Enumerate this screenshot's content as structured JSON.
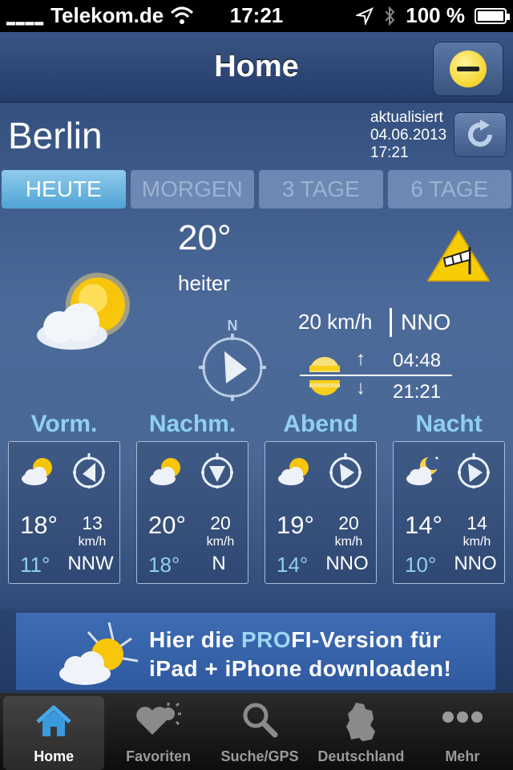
{
  "statusbar": {
    "carrier": "Telekom.de",
    "time": "17:21",
    "battery": "100 %"
  },
  "navbar": {
    "title": "Home"
  },
  "location": {
    "city": "Berlin",
    "updated_label": "aktualisiert",
    "updated_date": "04.06.2013",
    "updated_time": "17:21"
  },
  "tabs": [
    {
      "label": "HEUTE",
      "active": true
    },
    {
      "label": "MORGEN",
      "active": false
    },
    {
      "label": "3 TAGE",
      "active": false
    },
    {
      "label": "6 TAGE",
      "active": false
    }
  ],
  "current": {
    "temperature": "20°",
    "condition": "heiter",
    "wind_speed": "20 km/h",
    "wind_direction": "NNO",
    "compass_label": "N",
    "sunrise": "04:48",
    "sunset": "21:21"
  },
  "periods": [
    {
      "name": "Vorm.",
      "tmax": "18°",
      "tmin": "11°",
      "wind_speed": "13",
      "wind_unit": "km/h",
      "wind_dir": "NNW",
      "icon": "sun-cloud-icon"
    },
    {
      "name": "Nachm.",
      "tmax": "20°",
      "tmin": "18°",
      "wind_speed": "20",
      "wind_unit": "km/h",
      "wind_dir": "N",
      "icon": "sun-cloud-icon"
    },
    {
      "name": "Abend",
      "tmax": "19°",
      "tmin": "14°",
      "wind_speed": "20",
      "wind_unit": "km/h",
      "wind_dir": "NNO",
      "icon": "sun-cloud-icon"
    },
    {
      "name": "Nacht",
      "tmax": "14°",
      "tmin": "10°",
      "wind_speed": "14",
      "wind_unit": "km/h",
      "wind_dir": "NNO",
      "icon": "moon-cloud-icon"
    }
  ],
  "banner": {
    "line1_pre": "Hier die ",
    "line1_pro": "PRO",
    "line1_post": "FI-Version für",
    "line2": "iPad + iPhone downloaden!"
  },
  "tabbar": [
    {
      "label": "Home",
      "icon": "home-icon",
      "active": true
    },
    {
      "label": "Favoriten",
      "icon": "favorites-icon",
      "active": false
    },
    {
      "label": "Suche/GPS",
      "icon": "search-icon",
      "active": false
    },
    {
      "label": "Deutschland",
      "icon": "germany-map-icon",
      "active": false
    },
    {
      "label": "Mehr",
      "icon": "more-icon",
      "active": false
    }
  ],
  "colors": {
    "accent": "#8fd0ee",
    "active_tab": "#4fa4d6",
    "sun": "#f5c400"
  }
}
